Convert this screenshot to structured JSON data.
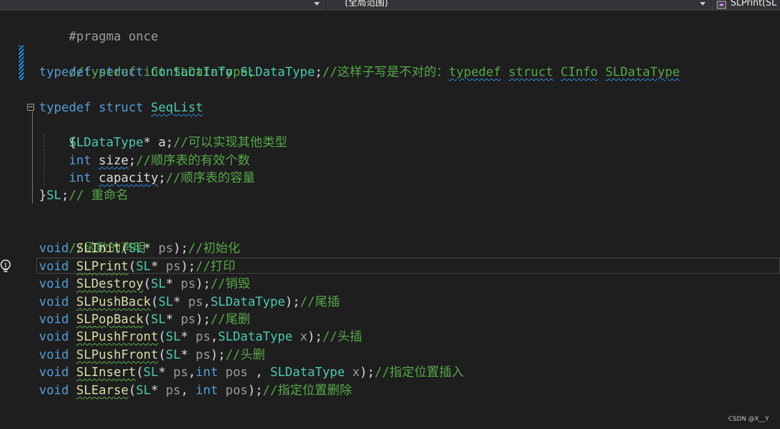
{
  "toolbar": {
    "scope_dropdown": "(全局范围)",
    "member_dropdown": "SLPrint(SL"
  },
  "code": {
    "l1": "#pragma once",
    "l2": "//typedef int SLDataType;",
    "l3_kw": "typedef",
    "l3_struct": "struct",
    "l3_type": "ContactInfo",
    "l3_name": "SLDataType",
    "l3_comment_a": "//这样子写是不对的：",
    "l3_comment_b": "typedef",
    "l3_comment_c": "struct",
    "l3_comment_d": "CInfo",
    "l3_comment_e": "SLDataType",
    "l4_kw": "typedef",
    "l4_struct": "struct",
    "l4_name": "SeqList",
    "l5": "{",
    "l6_type": "SLDataType",
    "l6_rest": "* a;",
    "l6_comment": "//可以实现其他类型",
    "l7_kw": "int",
    "l7_name": "size",
    "l7_semi": ";",
    "l7_comment": "//顺序表的有效个数",
    "l8_kw": "int",
    "l8_name": "capacity",
    "l8_semi": ";",
    "l8_comment": "//顺序表的容量",
    "l9_brace": "}",
    "l9_type": "SL",
    "l9_semi": ";",
    "l9_comment": "// 重命名",
    "l10": "//函数的声明",
    "decls": [
      {
        "fn": "SLInit",
        "args": "(SL* ps);",
        "comment": "//初始化"
      },
      {
        "fn": "SLPrint",
        "args": "(SL* ps);",
        "comment": "//打印"
      },
      {
        "fn": "SLDestroy",
        "args": "(SL* ps);",
        "comment": "//销毁"
      },
      {
        "fn": "SLPushBack",
        "args": "(SL* ps,SLDataType);",
        "comment": "//尾插"
      },
      {
        "fn": "SLPopBack",
        "args": "(SL* ps);",
        "comment": "//尾删"
      },
      {
        "fn": "SLPushFront",
        "args": "(SL* ps,SLDataType x);",
        "comment": "//头插"
      },
      {
        "fn": "SLPushFront",
        "args": "(SL* ps);",
        "comment": "//头删"
      },
      {
        "fn": "SLInsert",
        "args": "(SL* ps,int pos , SLDataType x);",
        "comment": "//指定位置插入"
      },
      {
        "fn": "SLEarse",
        "args": "(SL* ps, int pos);",
        "comment": "//指定位置删除"
      }
    ],
    "void_kw": "void"
  },
  "watermark": "CSDN @X__Y",
  "icons": {
    "lightbulb": "lightbulb-icon",
    "dropdown": "chevron-down-icon",
    "collapse": "collapse-icon",
    "method": "method-icon"
  }
}
